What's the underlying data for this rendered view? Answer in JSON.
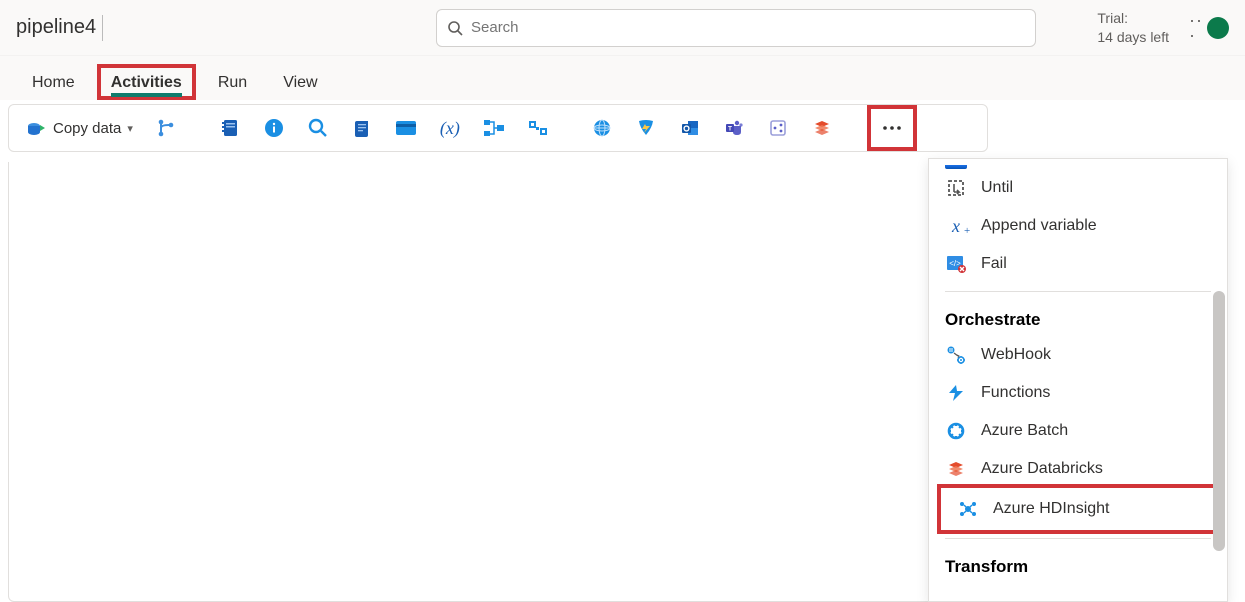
{
  "header": {
    "title": "pipeline4",
    "search_placeholder": "Search",
    "trial_line1": "Trial:",
    "trial_line2": "14 days left"
  },
  "tabs": [
    {
      "label": "Home",
      "active": false
    },
    {
      "label": "Activities",
      "active": true
    },
    {
      "label": "Run",
      "active": false
    },
    {
      "label": "View",
      "active": false
    }
  ],
  "toolbar": {
    "copy_data_label": "Copy data"
  },
  "dropdown": {
    "iteration_items": [
      {
        "name": "until-item",
        "icon": "until-icon",
        "label": "Until"
      },
      {
        "name": "append-var-item",
        "icon": "append-var-icon",
        "label": "Append variable"
      },
      {
        "name": "fail-item",
        "icon": "fail-icon",
        "label": "Fail"
      }
    ],
    "orchestrate_header": "Orchestrate",
    "orchestrate_items": [
      {
        "name": "webhook-item",
        "icon": "webhook-icon",
        "label": "WebHook"
      },
      {
        "name": "functions-item",
        "icon": "functions-icon",
        "label": "Functions"
      },
      {
        "name": "azure-batch-item",
        "icon": "azure-batch-icon",
        "label": "Azure Batch"
      },
      {
        "name": "azure-databricks-item",
        "icon": "azure-databricks-icon",
        "label": "Azure Databricks"
      },
      {
        "name": "azure-hdinsight-item",
        "icon": "azure-hdinsight-icon",
        "label": "Azure HDInsight",
        "highlighted": true
      }
    ],
    "transform_header": "Transform"
  }
}
